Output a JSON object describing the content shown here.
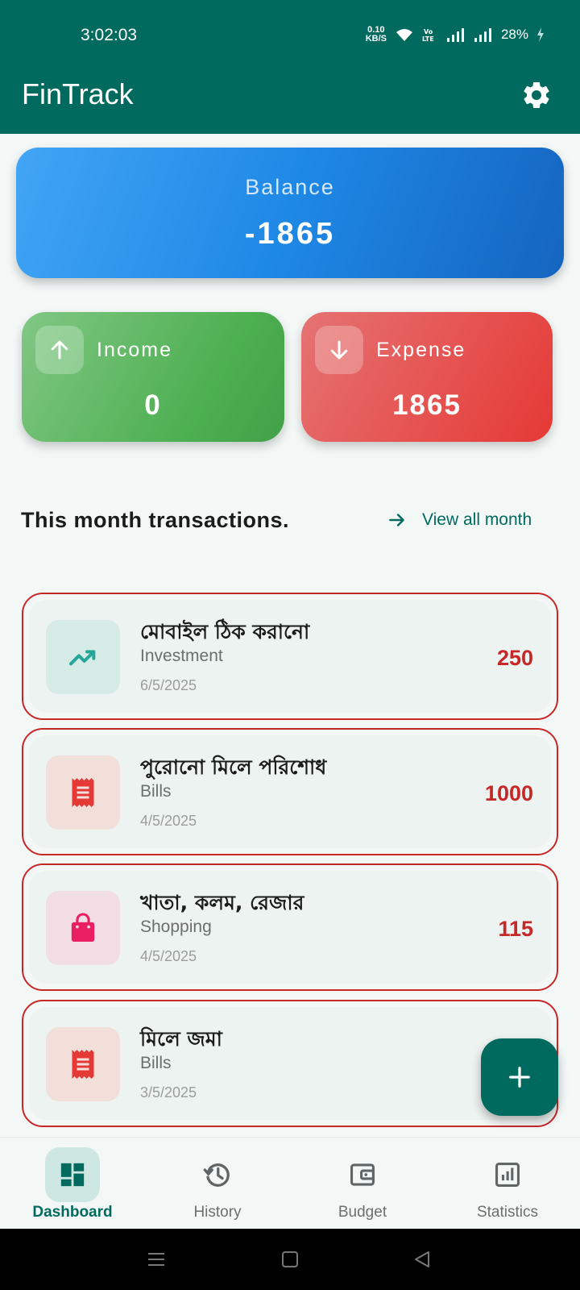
{
  "status_bar": {
    "time": "3:02:03",
    "net_speed_top": "0.10",
    "net_speed_bottom": "KB/S",
    "battery": "28%",
    "icons": [
      "wifi-icon",
      "volte-icon",
      "signal-icon",
      "signal-icon",
      "charging-icon"
    ]
  },
  "app_bar": {
    "title": "FinTrack",
    "settings_icon": "gear-icon"
  },
  "balance": {
    "label": "Balance",
    "value": "-1865"
  },
  "income": {
    "label": "Income",
    "value": "0",
    "icon": "arrow-up-icon"
  },
  "expense": {
    "label": "Expense",
    "value": "1865",
    "icon": "arrow-down-icon"
  },
  "transactions_section": {
    "title": "This month transactions.",
    "view_all_label": "View all month"
  },
  "transactions": [
    {
      "title": "মোবাইল ঠিক করানো",
      "category": "Investment",
      "date": "6/5/2025",
      "amount": "250",
      "icon": "trending-up-icon"
    },
    {
      "title": "পুরোনো মিলে পরিশোধ",
      "category": "Bills",
      "date": "4/5/2025",
      "amount": "1000",
      "icon": "receipt-icon"
    },
    {
      "title": "খাতা, কলম, রেজার",
      "category": "Shopping",
      "date": "4/5/2025",
      "amount": "115",
      "icon": "shopping-bag-icon"
    },
    {
      "title": "মিলে জমা",
      "category": "Bills",
      "date": "3/5/2025",
      "amount": "",
      "icon": "receipt-icon"
    }
  ],
  "colors": {
    "primary": "#006a5f",
    "expense_red": "#c62828",
    "income_green": "#4caf50",
    "balance_blue": "#1e88e5"
  },
  "bottom_nav": [
    {
      "label": "Dashboard",
      "icon": "dashboard-icon",
      "active": true
    },
    {
      "label": "History",
      "icon": "history-icon",
      "active": false
    },
    {
      "label": "Budget",
      "icon": "wallet-icon",
      "active": false
    },
    {
      "label": "Statistics",
      "icon": "statistics-icon",
      "active": false
    }
  ]
}
